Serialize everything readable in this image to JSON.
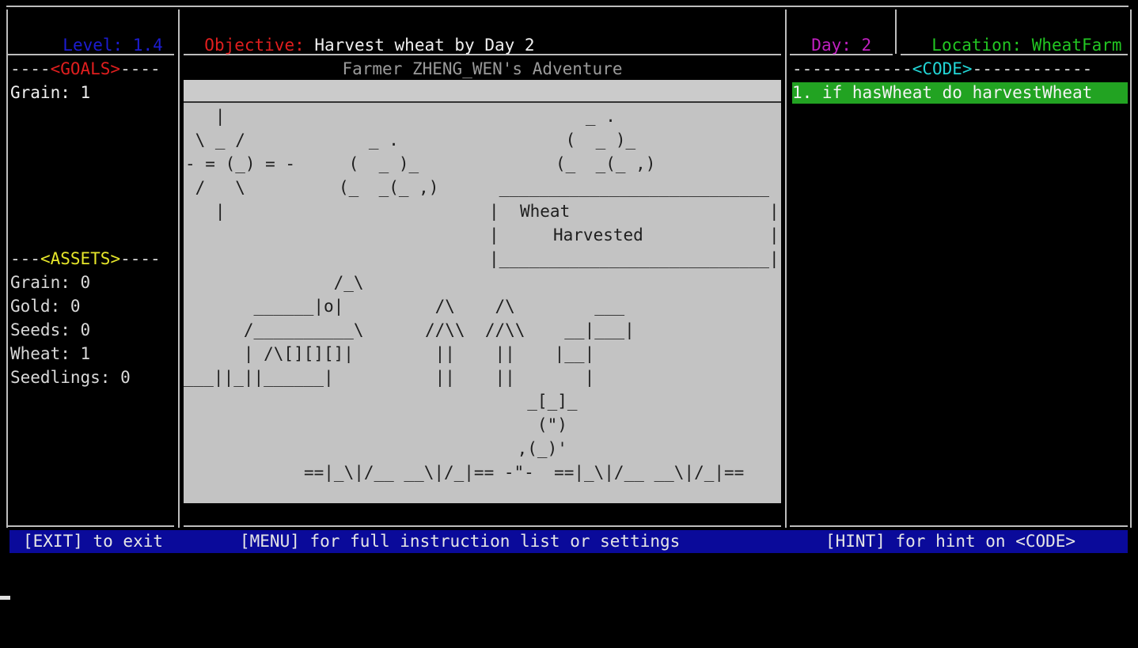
{
  "header": {
    "level_label": "Level:",
    "level_value": "1.4",
    "objective_label": "Objective:",
    "objective_text": "Harvest wheat by Day 2",
    "day_label": "Day:",
    "day_value": "2",
    "location_label": "Location:",
    "location_value": "WheatFarm"
  },
  "goals": {
    "heading_left": "----",
    "heading": "<GOALS>",
    "heading_right": "----",
    "items": [
      "Grain: 1"
    ]
  },
  "assets": {
    "heading_left": "---",
    "heading": "<ASSETS>",
    "heading_right": "----",
    "items": [
      "Grain: 0",
      "Gold: 0",
      "Seeds: 0",
      "Wheat: 1",
      "Seedlings: 0"
    ]
  },
  "game": {
    "title": "Farmer ZHENG_WEN's Adventure",
    "sign_line1": "Wheat",
    "sign_line2": "Harvested",
    "art": {
      "sun": "   |\n \\ _ /\n- = (_) = -\n /   \\\n   |",
      "cloud_small": "   _ .\n (  _ )_\n(_  _(_ ,)",
      "cloud_big": "   _ .\n (  _ )_\n(_  _(_ ,)",
      "sign_box": " ___________________________\n|                           |\n|                           |\n|___________________________|",
      "barn": "               /_\\\n       ______|o|\n      /__________\\\n      | /\\[][][]|\n___||_||______|",
      "trees": " /\\    /\\\n//\\\\  //\\\\\n ||    ||\n ||    ||",
      "well": "     ___\n  __|___|\n |__|\n    |",
      "farmer": "  _[_]_\n   (\")\n ,(_)'\n",
      "ground": "==|_\\|/__ __\\|/_|== -\"-  ==|_\\|/__ __\\|/_|=="
    }
  },
  "code": {
    "heading_left": "------------",
    "heading": "<CODE>",
    "heading_right": "------------",
    "lines": [
      "1. if hasWheat do harvestWheat"
    ]
  },
  "footer": {
    "exit_hint": "[EXIT] to exit",
    "menu_hint": "[MENU] for full instruction list or settings",
    "hint_hint": "[HINT] for hint on <CODE>"
  },
  "colors": {
    "level": "#1c1cd0",
    "objective_label": "#e01e1e",
    "day": "#c020c0",
    "location": "#22c622",
    "goals_heading": "#e01e1e",
    "assets_heading": "#e6e62a",
    "code_heading": "#22d6d6",
    "footer_bg": "#0a0a9a",
    "code_line_bg": "#22a322"
  }
}
